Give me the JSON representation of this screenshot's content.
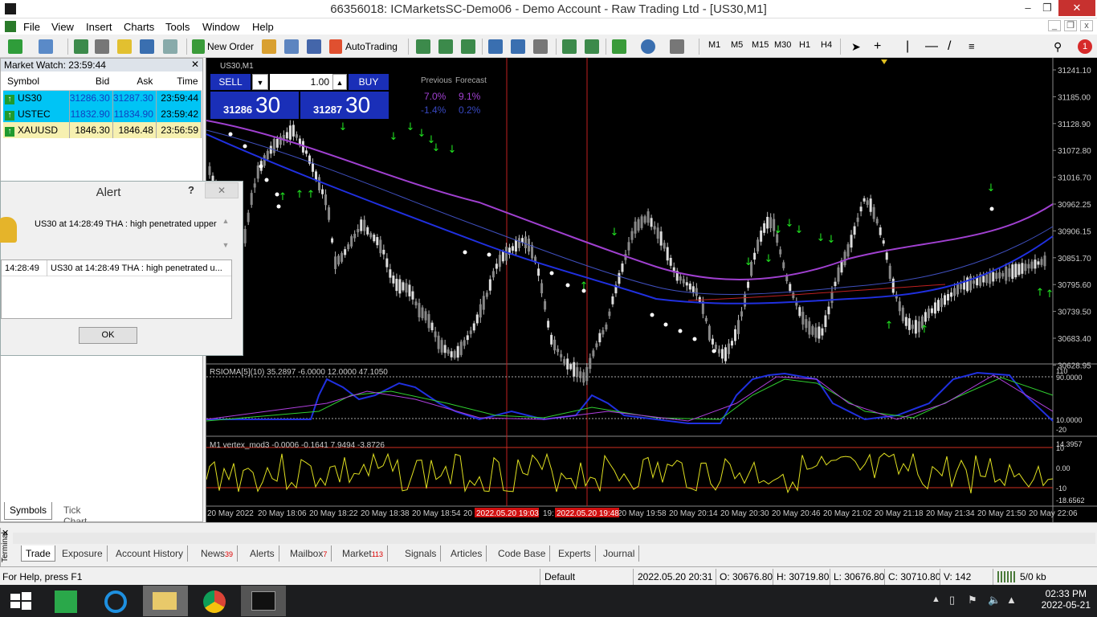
{
  "window": {
    "title": "66356018: ICMarketsSC-Demo06 - Demo Account - Raw Trading Ltd - [US30,M1]"
  },
  "menu": [
    "File",
    "View",
    "Insert",
    "Charts",
    "Tools",
    "Window",
    "Help"
  ],
  "toolbar": {
    "new_order": "New Order",
    "autotrading": "AutoTrading",
    "timeframes": [
      "M1",
      "M5",
      "M15",
      "M30",
      "H1",
      "H4"
    ],
    "notif_count": "1"
  },
  "market_watch": {
    "header": "Market Watch: 23:59:44",
    "columns": [
      "Symbol",
      "Bid",
      "Ask",
      "Time"
    ],
    "rows": [
      {
        "symbol": "US30",
        "bid": "31286.30",
        "ask": "31287.30",
        "time": "23:59:44"
      },
      {
        "symbol": "USTEC",
        "bid": "11832.90",
        "ask": "11834.90",
        "time": "23:59:42"
      },
      {
        "symbol": "XAUUSD",
        "bid": "1846.30",
        "ask": "1846.48",
        "time": "23:56:59"
      }
    ],
    "tabs": [
      "Symbols",
      "Tick Chart"
    ]
  },
  "alert": {
    "title": "Alert",
    "help": "?",
    "message": "US30 at 14:28:49 THA : high penetrated upper",
    "list_time": "14:28:49",
    "list_message": "US30 at 14:28:49 THA : high penetrated u...",
    "ok": "OK"
  },
  "chart": {
    "symbol_label": "US30,M1",
    "sell": "SELL",
    "buy": "BUY",
    "lot": "1.00",
    "sell_small": "31286",
    "sell_big": "30",
    "buy_small": "31287",
    "buy_big": "30",
    "prev_label": "Previous",
    "forecast_label": "Forecast",
    "prev1": "7.0%",
    "fore1": "9.1%",
    "prev2": "-1.4%",
    "fore2": "0.2%",
    "price_axis": [
      "31241.10",
      "31185.00",
      "31128.90",
      "31072.80",
      "31016.70",
      "30962.25",
      "30906.15",
      "30851.70",
      "30795.60",
      "30739.50",
      "30683.40",
      "30628.95"
    ],
    "rsi_label": "RSIOMA[5](10) 35.2897 -6.0000 12.0000 47.1050",
    "rsi_axis": [
      "110",
      "90.0000",
      "10.0000",
      "-20"
    ],
    "vertex_label": "M1 vertex_mod3 -0.0006 -0.1641 7.9494 -3.8726",
    "vertex_axis": [
      "14.3957",
      "10",
      "0.00",
      "-10",
      "-18.6562"
    ],
    "time_axis": [
      "20 May 2022",
      "20 May 18:06",
      "20 May 18:22",
      "20 May 18:38",
      "20 May 18:54",
      "20",
      "19:",
      "20 May 19:58",
      "20 May 20:14",
      "20 May 20:30",
      "20 May 20:46",
      "20 May 21:02",
      "20 May 21:18",
      "20 May 21:34",
      "20 May 21:50",
      "20 May 22:06"
    ],
    "time_markers": [
      "2022.05.20 19:03",
      "2022.05.20 19:48"
    ]
  },
  "terminal": {
    "side_label": "Terminal",
    "tabs": [
      {
        "label": "Trade",
        "badge": ""
      },
      {
        "label": "Exposure",
        "badge": ""
      },
      {
        "label": "Account History",
        "badge": ""
      },
      {
        "label": "News",
        "badge": "39"
      },
      {
        "label": "Alerts",
        "badge": ""
      },
      {
        "label": "Mailbox",
        "badge": "7"
      },
      {
        "label": "Market",
        "badge": "113"
      },
      {
        "label": "Signals",
        "badge": ""
      },
      {
        "label": "Articles",
        "badge": ""
      },
      {
        "label": "Code Base",
        "badge": ""
      },
      {
        "label": "Experts",
        "badge": ""
      },
      {
        "label": "Journal",
        "badge": ""
      }
    ]
  },
  "status": {
    "help": "For Help, press F1",
    "profile": "Default",
    "datetime": "2022.05.20 20:31",
    "open": "O: 30676.80",
    "high": "H: 30719.80",
    "low": "L: 30676.80",
    "close": "C: 30710.80",
    "volume": "V: 142",
    "traffic": "5/0 kb"
  },
  "taskbar": {
    "time": "02:33 PM",
    "date": "2022-05-21"
  },
  "colors": {
    "sell_buy": "#1a2fb8",
    "mw_blue": "#00c4f5",
    "mw_yellow": "#f6f0b0",
    "ma_purple": "#a040d0",
    "ma_blue": "#2030e0",
    "vertex": "#e0e020"
  }
}
